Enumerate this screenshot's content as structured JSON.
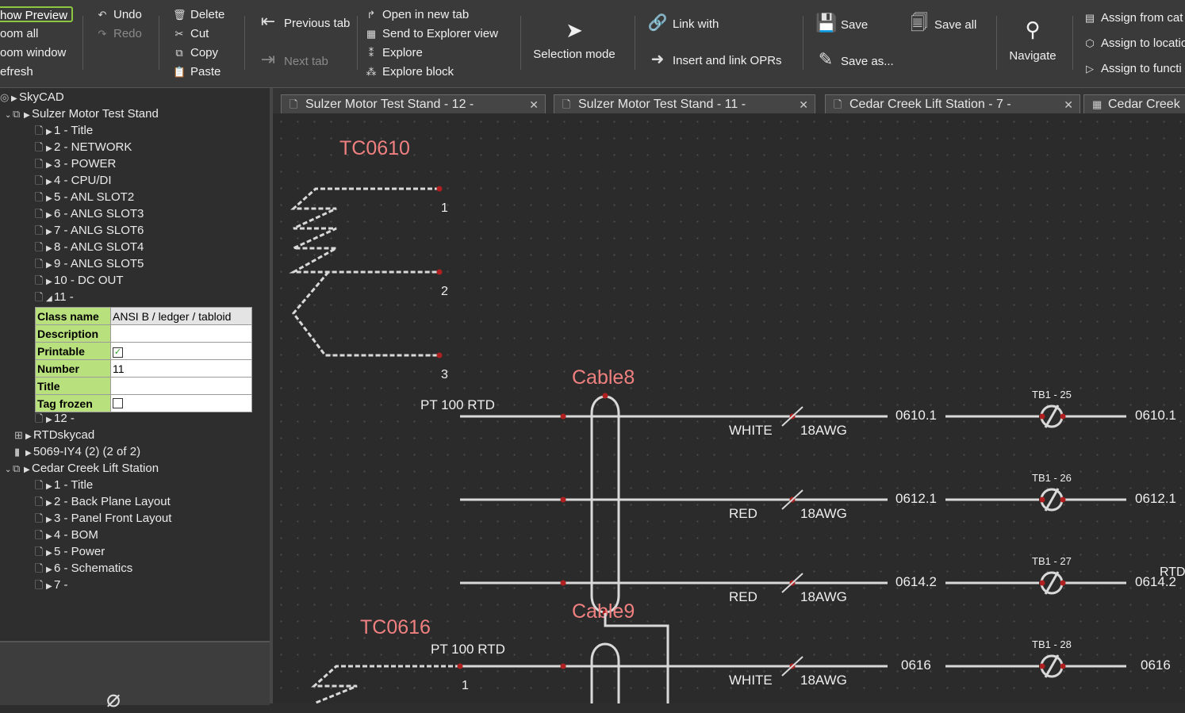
{
  "ribbon": {
    "preview": "how Preview",
    "zoom_all": "oom all",
    "zoom_window": "oom window",
    "refresh": "efresh",
    "undo": "Undo",
    "redo": "Redo",
    "delete": "Delete",
    "cut": "Cut",
    "copy": "Copy",
    "paste": "Paste",
    "previous_tab": "Previous tab",
    "next_tab": "Next tab",
    "open_new_tab": "Open in new tab",
    "send_explorer": "Send to Explorer view",
    "explore": "Explore",
    "explore_block": "Explore block",
    "selection_mode": "Selection mode",
    "link_with": "Link with",
    "insert_link": "Insert and link OPRs",
    "save": "Save",
    "save_as": "Save as...",
    "save_all": "Save all",
    "navigate": "Navigate",
    "assign_cat": "Assign from cat",
    "assign_loc": "Assign to locatio",
    "assign_func": "Assign to functi"
  },
  "tree": {
    "root": "SkyCAD",
    "project1": "Sulzer Motor Test Stand",
    "pages1": [
      "1 - Title",
      "2 - NETWORK",
      "3 - POWER",
      "4 - CPU/DI",
      "5 - ANL SLOT2",
      "6 - ANLG SLOT3",
      "7 - ANLG SLOT6",
      "8 - ANLG SLOT4",
      "9 - ANLG SLOT5",
      "10 - DC OUT",
      "11 -"
    ],
    "page12": "12 -",
    "rtd": "RTDskycad",
    "module": "5069-IY4 (2) (2 of 2)",
    "project2": "Cedar Creek Lift Station",
    "pages2": [
      "1 - Title",
      "2 - Back Plane Layout",
      "3 - Panel Front Layout",
      "4 - BOM",
      "5 - Power",
      "6 - Schematics",
      "7 -"
    ]
  },
  "properties": {
    "class_name_label": "Class name",
    "class_name_value": "ANSI B / ledger / tabloid",
    "description_label": "Description",
    "description_value": "",
    "printable_label": "Printable",
    "printable_checked": true,
    "number_label": "Number",
    "number_value": "11",
    "title_label": "Title",
    "title_value": "",
    "tag_frozen_label": "Tag frozen",
    "tag_frozen_checked": false
  },
  "tabs": [
    {
      "label": "Sulzer Motor Test Stand - 12 -"
    },
    {
      "label": "Sulzer Motor Test Stand - 11 -"
    },
    {
      "label": "Cedar Creek Lift Station - 7 -"
    },
    {
      "label": "Cedar Creek"
    }
  ],
  "schematic": {
    "tag1": "TC0610",
    "pin1": "1",
    "pin2": "2",
    "pin3": "3",
    "cable8": "Cable8",
    "cable9": "Cable9",
    "rtd_label": "PT 100 RTD",
    "tag2": "TC0616",
    "rtd_label2": "PT 100 RTD",
    "pin_b1": "1",
    "rtd_right": "RTD",
    "rows": [
      {
        "color": "WHITE",
        "gauge": "18AWG",
        "wire": "0610.1",
        "terminal": "TB1 - 25",
        "out": "0610.1"
      },
      {
        "color": "RED",
        "gauge": "18AWG",
        "wire": "0612.1",
        "terminal": "TB1 - 26",
        "out": "0612.1"
      },
      {
        "color": "RED",
        "gauge": "18AWG",
        "wire": "0614.2",
        "terminal": "TB1 - 27",
        "out": "0614.2"
      },
      {
        "color": "WHITE",
        "gauge": "18AWG",
        "wire": "0616",
        "terminal": "TB1 - 28",
        "out": "0616"
      }
    ],
    "colors": {
      "tag": "#f08080",
      "wire": "#d9d9d9",
      "dot": "#b02020"
    }
  }
}
